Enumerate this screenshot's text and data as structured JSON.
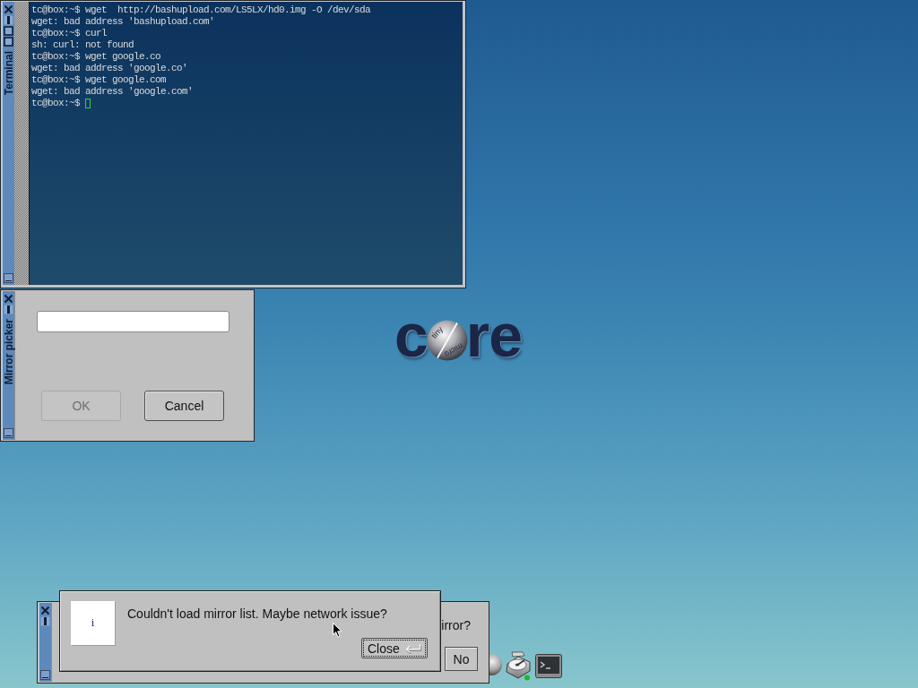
{
  "terminal": {
    "title": "Terminal",
    "lines": [
      "tc@box:~$ wget  http://bashupload.com/LS5LX/hd0.img -O /dev/sda",
      "wget: bad address 'bashupload.com'",
      "tc@box:~$ curl",
      "sh: curl: not found",
      "tc@box:~$ wget google.co",
      "wget: bad address 'google.co'",
      "tc@box:~$ wget google.com",
      "wget: bad address 'google.com'"
    ],
    "prompt": "tc@box:~$"
  },
  "desktop_logo": {
    "parts": [
      {
        "kind": "letters",
        "text": "c"
      },
      {
        "kind": "sphere",
        "top": "tiny",
        "bottom": "micro"
      },
      {
        "kind": "letters",
        "text": "re"
      }
    ]
  },
  "mirror_picker": {
    "title": "Mirror picker",
    "buttons": [
      {
        "label": "OK",
        "disabled": true
      },
      {
        "label": "Cancel",
        "disabled": false
      }
    ]
  },
  "question_dialog": {
    "text": "irror?",
    "button": {
      "label": "No"
    }
  },
  "message_dialog": {
    "icon_glyph": "i",
    "message": "Couldn't load mirror list. Maybe network issue?",
    "button": {
      "label": "Close",
      "focused": true
    }
  }
}
